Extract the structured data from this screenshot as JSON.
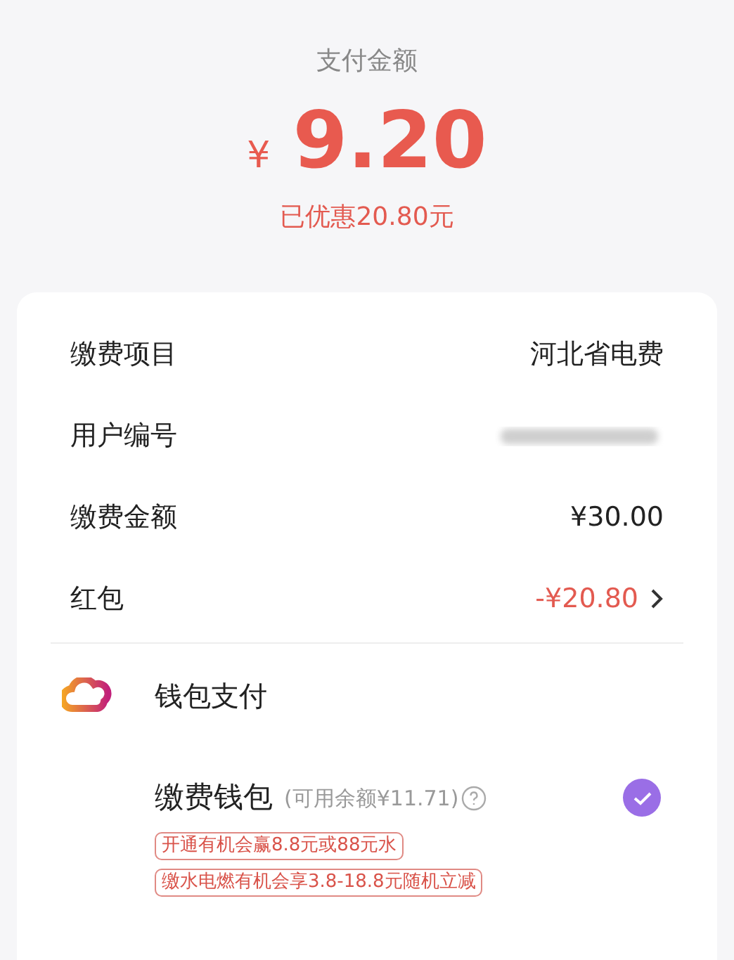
{
  "header": {
    "title": "支付金额",
    "currency": "¥",
    "amount": "9.20",
    "discount": "已优惠20.80元"
  },
  "details": [
    {
      "kind": "text",
      "label": "缴费项目",
      "value": "河北省电费"
    },
    {
      "kind": "hidden",
      "label": "用户编号"
    },
    {
      "kind": "text",
      "label": "缴费金额",
      "value": "¥30.00"
    },
    {
      "kind": "link",
      "label": "红包",
      "value": "-¥20.80"
    }
  ],
  "payment": {
    "title": "钱包支付",
    "options": [
      {
        "name": "缴费钱包",
        "balance": "(可用余额¥11.71)",
        "selected": true,
        "tags": [
          "开通有机会赢8.8元或88元水",
          "缴水电燃有机会享3.8-18.8元随机立减"
        ]
      }
    ]
  }
}
